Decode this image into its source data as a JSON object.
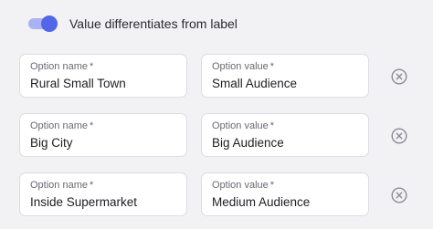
{
  "toggle": {
    "label": "Value differentiates from label",
    "on": true
  },
  "field_labels": {
    "name": "Option name",
    "value": "Option value",
    "required_mark": "*"
  },
  "options": [
    {
      "name": "Rural Small Town",
      "value": "Small Audience"
    },
    {
      "name": "Big City",
      "value": "Big Audience"
    },
    {
      "name": "Inside Supermarket",
      "value": "Medium Audience"
    }
  ],
  "icons": {
    "remove": "close-circle-icon"
  },
  "colors": {
    "accent": "#5266e8",
    "accent_light": "#aab2f3",
    "background": "#f2f2f5"
  }
}
